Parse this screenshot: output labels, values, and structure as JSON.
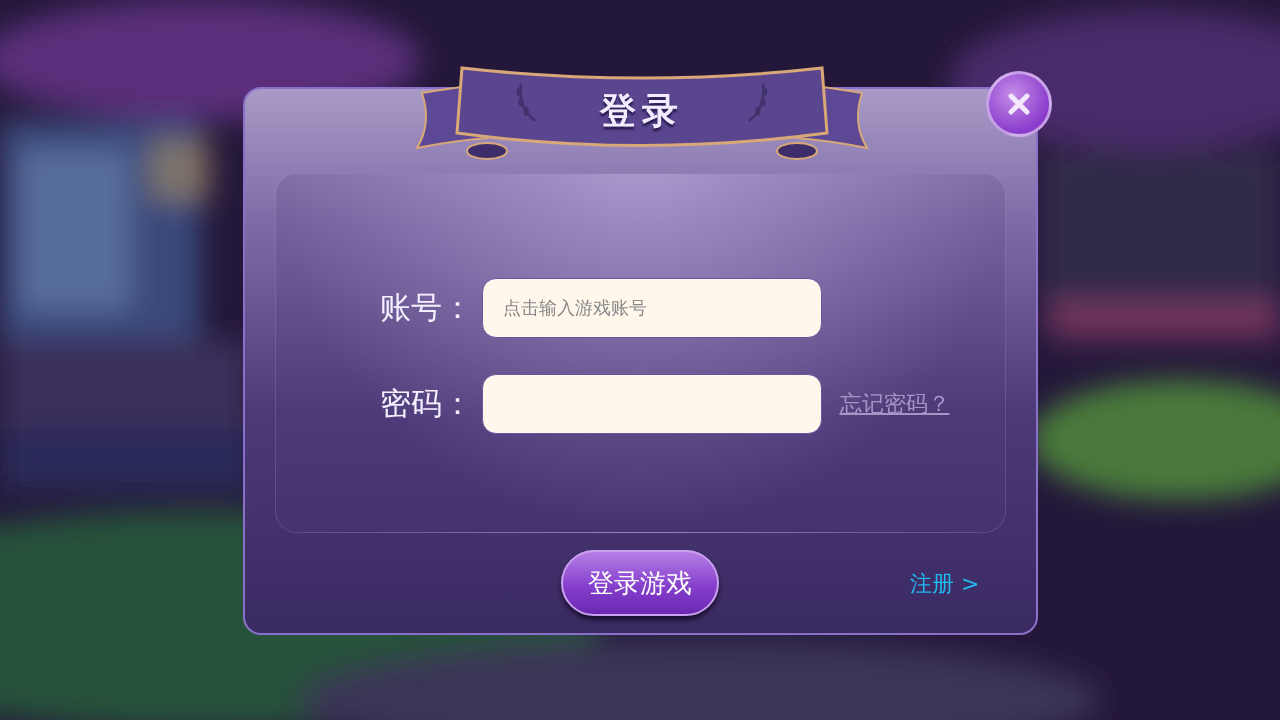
{
  "dialog": {
    "title": "登录"
  },
  "fields": [
    {
      "label": "账号：",
      "placeholder": "点击输入游戏账号"
    },
    {
      "label": "密码：",
      "link": "忘记密码？"
    }
  ],
  "login_button": "登录游戏",
  "register_link": "注册 >"
}
